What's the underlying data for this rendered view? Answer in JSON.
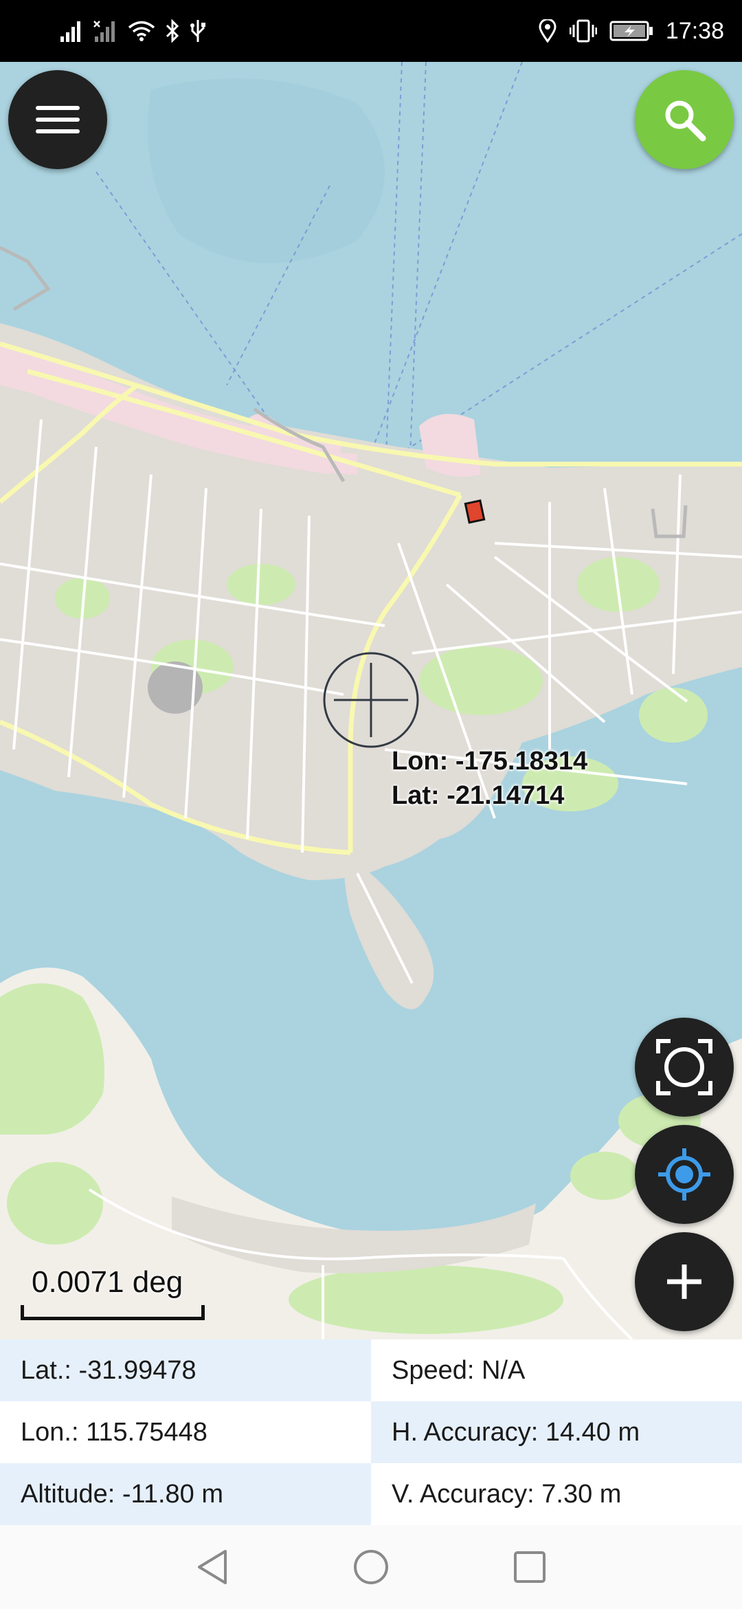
{
  "status_bar": {
    "time": "17:38",
    "icons": [
      "signal-icon",
      "signal-no-sim-icon",
      "wifi-icon",
      "bluetooth-icon",
      "usb-icon",
      "location-icon",
      "vibrate-icon",
      "battery-charging-icon"
    ]
  },
  "map": {
    "menu_icon": "hamburger-menu-icon",
    "search_icon": "search-icon",
    "crosshair_icon": "crosshair-icon",
    "center_readout": {
      "lon": "Lon: -175.18314",
      "lat": "Lat: -21.14714"
    },
    "scale_label": "0.0071 deg",
    "controls": {
      "fit_icon": "fit-screen-icon",
      "my_location_icon": "my-location-icon",
      "add_icon": "add-icon"
    },
    "colors": {
      "water": "#aad3df",
      "land": "#f2efe9",
      "urban": "#e0dcd6",
      "park": "#cdebb0",
      "commercial": "#f2dae0",
      "primary_road": "#f8f8b0",
      "accent_green": "#7ac943",
      "control_dark": "#212121",
      "location_blue": "#3d9be9"
    }
  },
  "info": {
    "lat": "Lat.: -31.99478",
    "speed": "Speed: N/A",
    "lon": "Lon.: 115.75448",
    "h_accuracy": "H. Accuracy: 14.40 m",
    "altitude": "Altitude: -11.80 m",
    "v_accuracy": "V. Accuracy: 7.30 m"
  },
  "nav_bar": {
    "back_icon": "back-triangle-icon",
    "home_icon": "home-circle-icon",
    "recents_icon": "recents-square-icon"
  }
}
